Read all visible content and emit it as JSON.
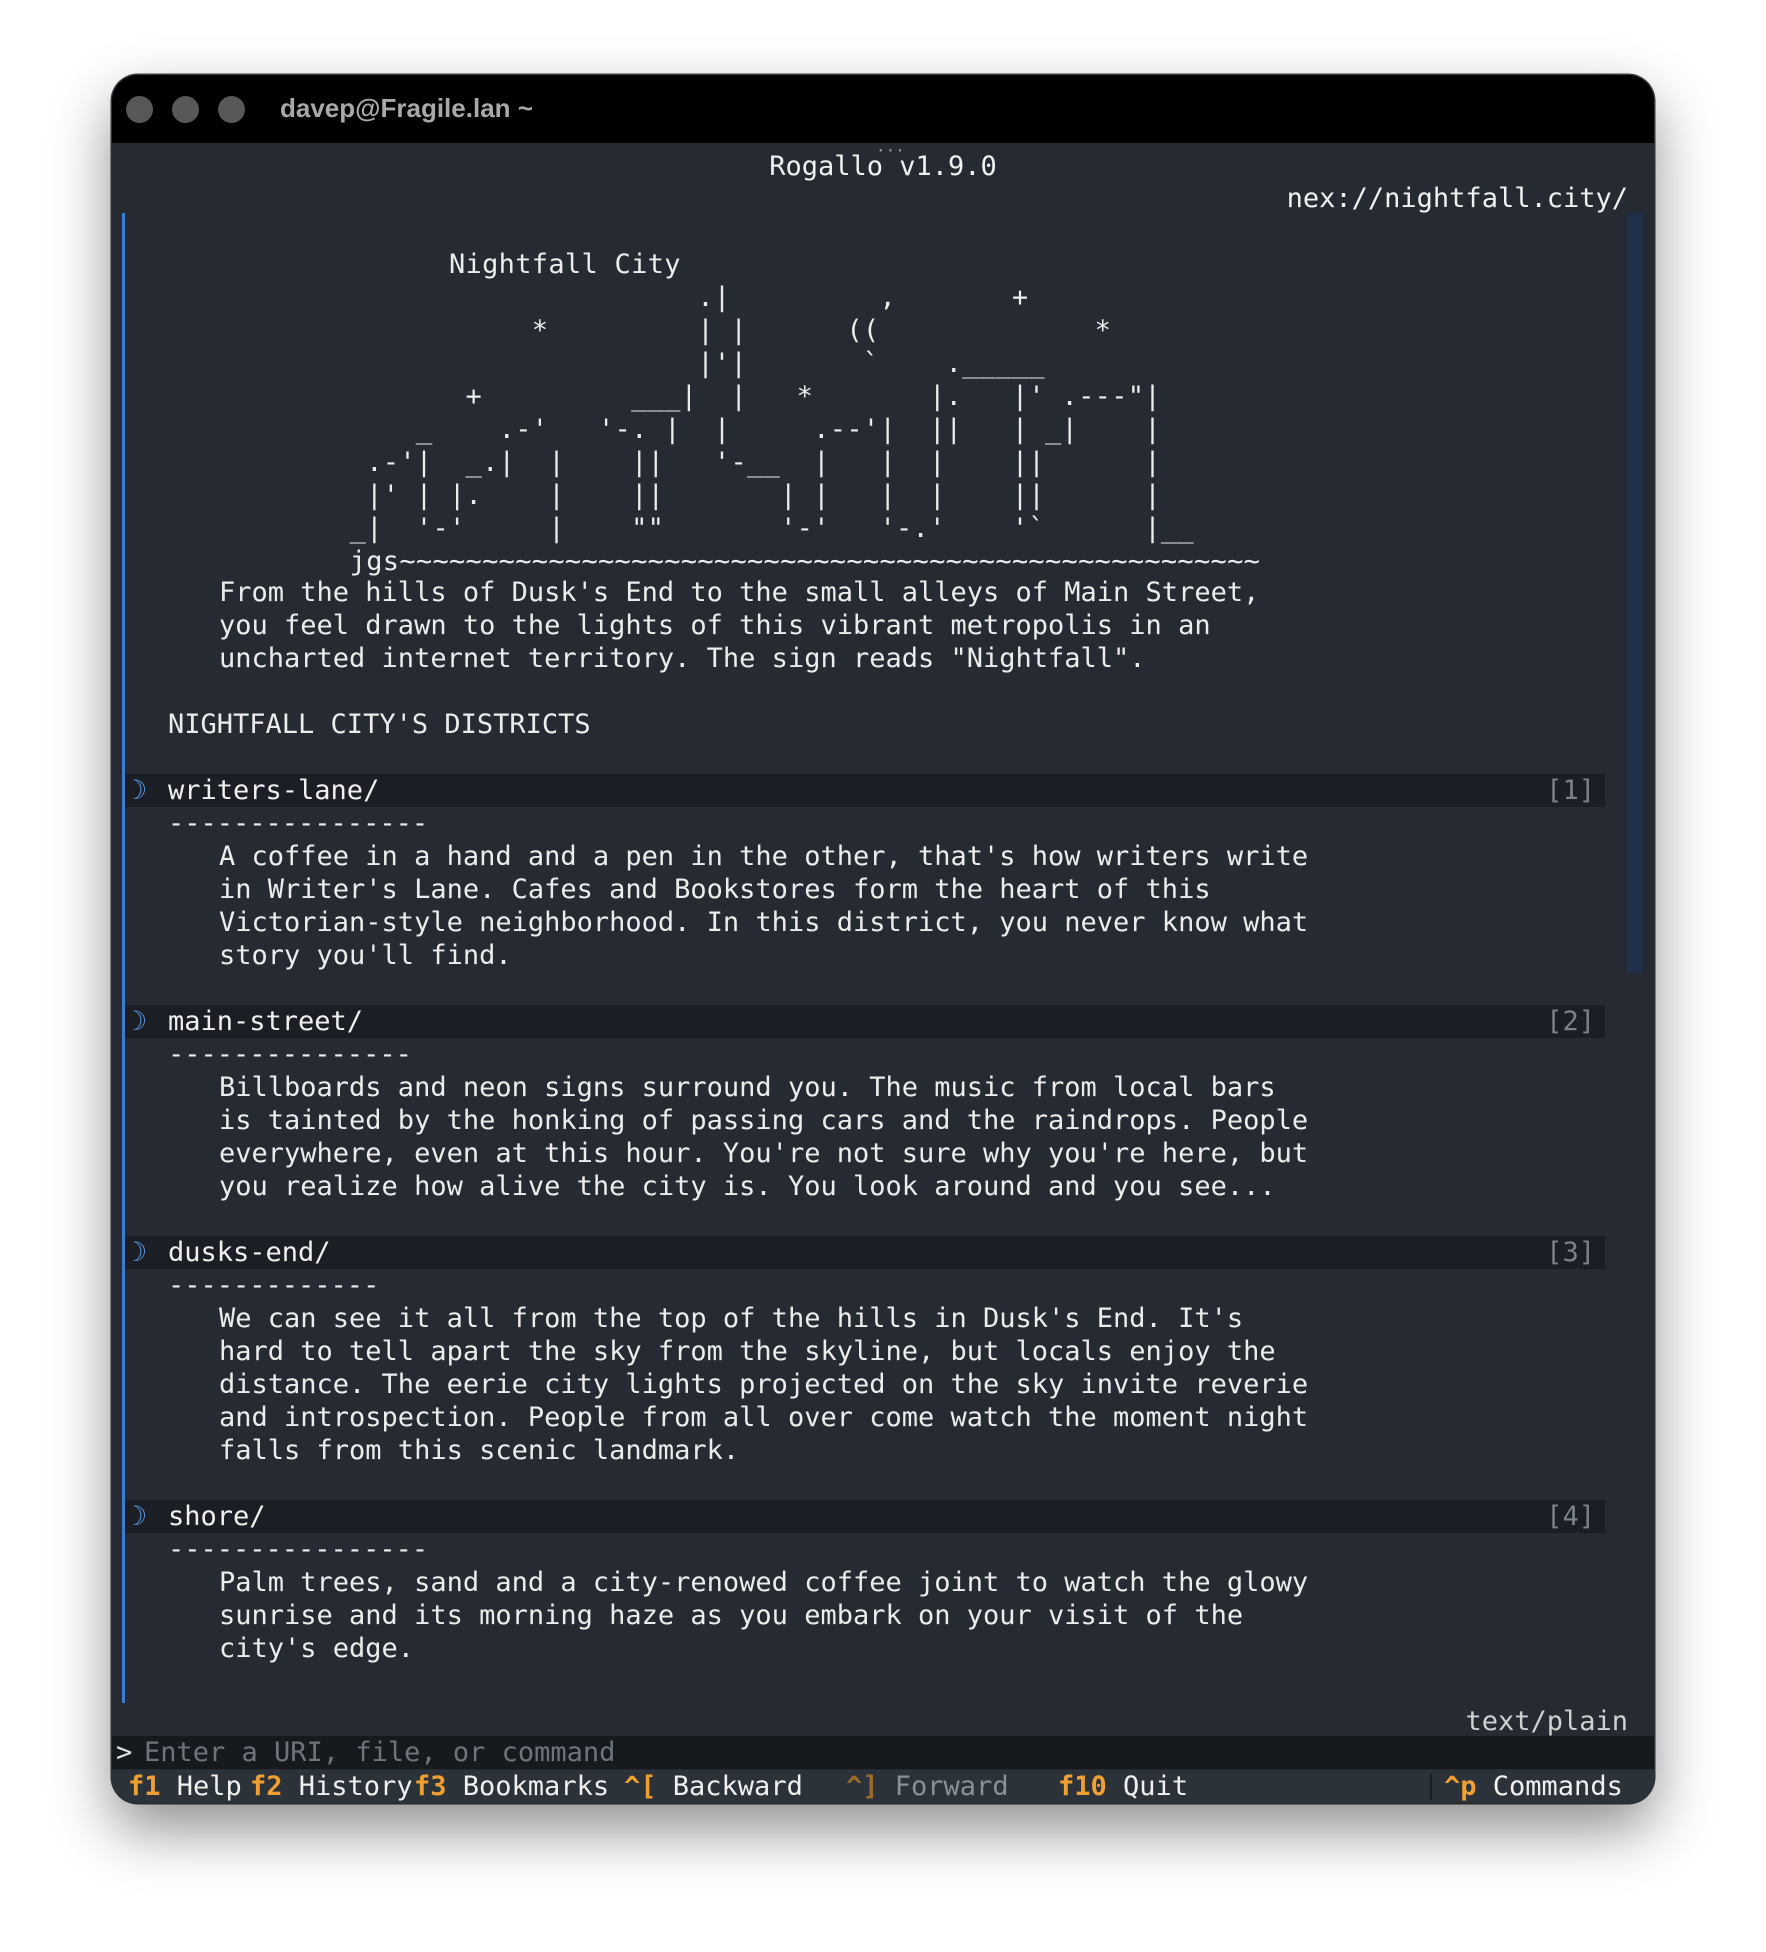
{
  "window": {
    "title": "davep@Fragile.lan ~"
  },
  "app": {
    "title": "Rogallo v1.9.0",
    "url": "nex://nightfall.city/",
    "mime": "text/plain"
  },
  "page": {
    "ascii_art": "         Nightfall City\n                        .|         ,       +\n              *         | |      ((             *\n                        |'|       `    ._____\n          +         ___|  |   *       |.   |' .---\"|\n       _    .-'   '-. |  |     .--'|  ||   | _|    |\n    .-'|  _.|  |    ||   '-__  |   |  |    ||      |\n    |' | |.    |    ||       | |   |  |    ||      |\n   _|  '-'     |    \"\"       '-'   '-.'    '`      |__\n   jgs~~~~~~~~~~~~~~~~~~~~~~~~~~~~~~~~~~~~~~~~~~~~~~~~~~~~",
    "intro": [
      "From the hills of Dusk's End to the small alleys of Main Street,",
      "you feel drawn to the lights of this vibrant metropolis in an",
      "uncharted internet territory. The sign reads \"Nightfall\"."
    ],
    "heading": "NIGHTFALL CITY'S DISTRICTS",
    "links": [
      {
        "icon": "☽",
        "label": "writers-lane/",
        "index": "[1]",
        "rule": "----------------",
        "desc": [
          "A coffee in a hand and a pen in the other, that's how writers write",
          "in Writer's Lane. Cafes and Bookstores form the heart of this",
          "Victorian-style neighborhood. In this district, you never know what",
          "story you'll find."
        ]
      },
      {
        "icon": "☽",
        "label": "main-street/",
        "index": "[2]",
        "rule": "---------------",
        "desc": [
          "Billboards and neon signs surround you. The music from local bars",
          "is tainted by the honking of passing cars and the raindrops. People",
          "everywhere, even at this hour. You're not sure why you're here, but",
          "you realize how alive the city is. You look around and you see..."
        ]
      },
      {
        "icon": "☽",
        "label": "dusks-end/",
        "index": "[3]",
        "rule": "-------------",
        "desc": [
          "We can see it all from the top of the hills in Dusk's End. It's",
          "hard to tell apart the sky from the skyline, but locals enjoy the",
          "distance. The eerie city lights projected on the sky invite reverie",
          "and introspection. People from all over come watch the moment night",
          "falls from this scenic landmark."
        ]
      },
      {
        "icon": "☽",
        "label": "shore/",
        "index": "[4]",
        "rule": "----------------",
        "desc": [
          "Palm trees, sand and a city-renowed coffee joint to watch the glowy",
          "sunrise and its morning haze as you embark on your visit of the",
          "city's edge."
        ]
      }
    ]
  },
  "command": {
    "prompt": ">",
    "placeholder": "Enter a URI, file, or command"
  },
  "footer": {
    "items": [
      {
        "key": "f1",
        "label": "Help"
      },
      {
        "key": "f2",
        "label": "History"
      },
      {
        "key": "f3",
        "label": "Bookmarks"
      },
      {
        "key": "^[",
        "label": "Backward"
      },
      {
        "key": "^]",
        "label": "Forward"
      },
      {
        "key": "f10",
        "label": "Quit"
      }
    ],
    "commands": {
      "key": "^p",
      "label": "Commands"
    }
  },
  "colors": {
    "background": "#262b33",
    "accent_key": "#f0a030",
    "link_icon": "#5a95e0",
    "content_border": "#3e7ccf"
  }
}
